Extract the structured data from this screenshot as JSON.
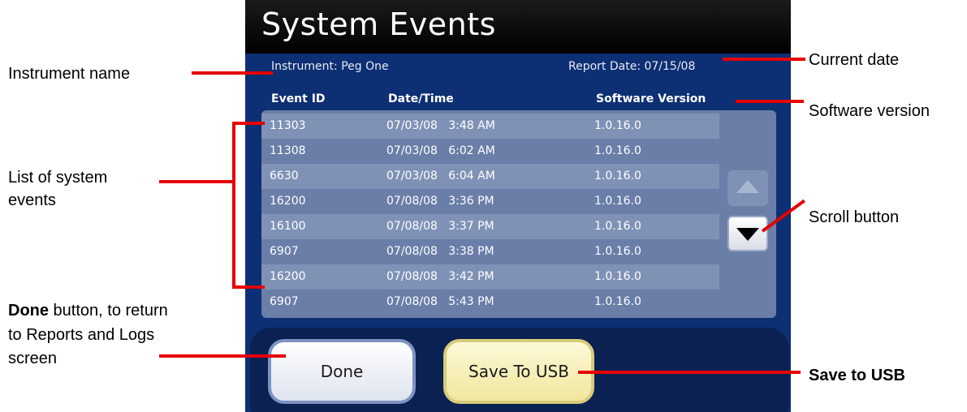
{
  "app": {
    "title": "System Events",
    "instrument_text": "Instrument: Peg One",
    "report_date_text": "Report Date: 07/15/08"
  },
  "table": {
    "headers": [
      "Event ID",
      "Date/Time",
      "Software Version"
    ],
    "rows": [
      {
        "id": "11303",
        "datetime": "07/03/08   3:48 AM",
        "version": "1.0.16.0"
      },
      {
        "id": "11308",
        "datetime": "07/03/08   6:02 AM",
        "version": "1.0.16.0"
      },
      {
        "id": "6630",
        "datetime": "07/03/08   6:04 AM",
        "version": "1.0.16.0"
      },
      {
        "id": "16200",
        "datetime": "07/08/08   3:36 PM",
        "version": "1.0.16.0"
      },
      {
        "id": "16100",
        "datetime": "07/08/08   3:37 PM",
        "version": "1.0.16.0"
      },
      {
        "id": "6907",
        "datetime": "07/08/08   3:38 PM",
        "version": "1.0.16.0"
      },
      {
        "id": "16200",
        "datetime": "07/08/08   3:42 PM",
        "version": "1.0.16.0"
      },
      {
        "id": "6907",
        "datetime": "07/08/08   5:43 PM",
        "version": "1.0.16.0"
      }
    ]
  },
  "buttons": {
    "done": "Done",
    "save_usb": "Save To USB"
  },
  "icons": {
    "scroll_up": "triangle-up-icon",
    "scroll_down": "triangle-down-icon"
  },
  "annotations": {
    "instrument_name": "Instrument name",
    "list_line1": "List of system",
    "list_line2": "events",
    "done_bold": "Done",
    "done_rest1": " button, to return",
    "done_rest2": "to Reports and Logs",
    "done_rest3": "screen",
    "current_date": "Current date",
    "software_version": "Software version",
    "scroll_button": "Scroll button",
    "save_usb": "Save to USB"
  },
  "colors": {
    "panel_bg": "#0d2f73",
    "list_bg": "#6a7ea8",
    "row_alt": "#7f92b6",
    "callout_line": "#e60000"
  }
}
